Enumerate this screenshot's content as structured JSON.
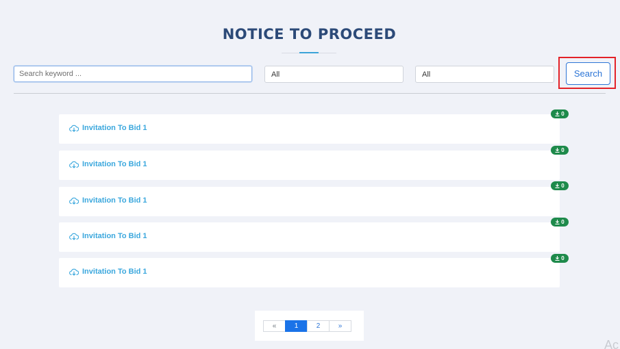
{
  "page": {
    "title": "NOTICE TO PROCEED"
  },
  "filters": {
    "search_placeholder": "Search keyword ...",
    "select_1": "All",
    "select_2": "All",
    "search_button": "Search"
  },
  "items": [
    {
      "label": "Invitation To Bid 1",
      "downloads": "0"
    },
    {
      "label": "Invitation To Bid 1",
      "downloads": "0"
    },
    {
      "label": "Invitation To Bid 1",
      "downloads": "0"
    },
    {
      "label": "Invitation To Bid 1",
      "downloads": "0"
    },
    {
      "label": "Invitation To Bid 1",
      "downloads": "0"
    }
  ],
  "pagination": {
    "prev": "«",
    "pages": [
      "1",
      "2"
    ],
    "active": "1",
    "next": "»"
  },
  "watermark": "Ac",
  "colors": {
    "accent": "#2b74d6",
    "title": "#2c4a78",
    "link": "#3aa7dd",
    "badge": "#1e8a4b",
    "highlight": "#e32127"
  },
  "icons": {
    "item_icon": "cloud-download-icon",
    "badge_icon": "download-icon"
  }
}
